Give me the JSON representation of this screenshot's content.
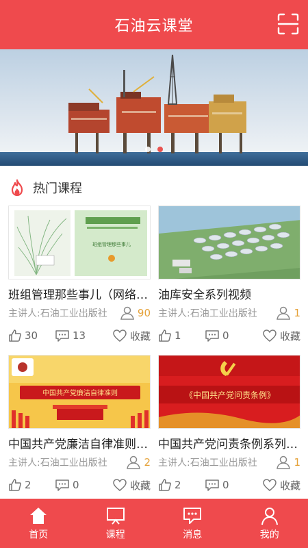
{
  "header": {
    "title": "石油云课堂",
    "scan_icon": "scan-icon"
  },
  "banner": {
    "slides": 2,
    "active_slide": 2
  },
  "section": {
    "title": "热门课程",
    "icon": "fire-icon"
  },
  "courses": [
    {
      "title": "班组管理那些事儿（网络…",
      "lecturer": "主讲人:石油工业出版社",
      "learners": "90",
      "likes": "30",
      "comments": "13",
      "fav_label": "收藏",
      "thumb_text": "班组管理那些事儿"
    },
    {
      "title": "油库安全系列视频",
      "lecturer": "主讲人:石油工业出版社",
      "learners": "1",
      "likes": "1",
      "comments": "0",
      "fav_label": "收藏",
      "thumb_text": ""
    },
    {
      "title": "中国共产党廉洁自律准则…",
      "lecturer": "主讲人:石油工业出版社",
      "learners": "2",
      "likes": "2",
      "comments": "0",
      "fav_label": "收藏",
      "thumb_text": "中国共产党廉洁自律准则"
    },
    {
      "title": "中国共产党问责条例系列…",
      "lecturer": "主讲人:石油工业出版社",
      "learners": "1",
      "likes": "2",
      "comments": "0",
      "fav_label": "收藏",
      "thumb_text": "《中国共产党问责条例》"
    }
  ],
  "tabbar": {
    "tabs": [
      {
        "label": "首页",
        "icon": "home-icon",
        "active": true
      },
      {
        "label": "课程",
        "icon": "course-icon",
        "active": false
      },
      {
        "label": "消息",
        "icon": "message-icon",
        "active": false
      },
      {
        "label": "我的",
        "icon": "profile-icon",
        "active": false
      }
    ]
  },
  "colors": {
    "brand": "#ef4a4d",
    "accent_count": "#e5a23a"
  }
}
